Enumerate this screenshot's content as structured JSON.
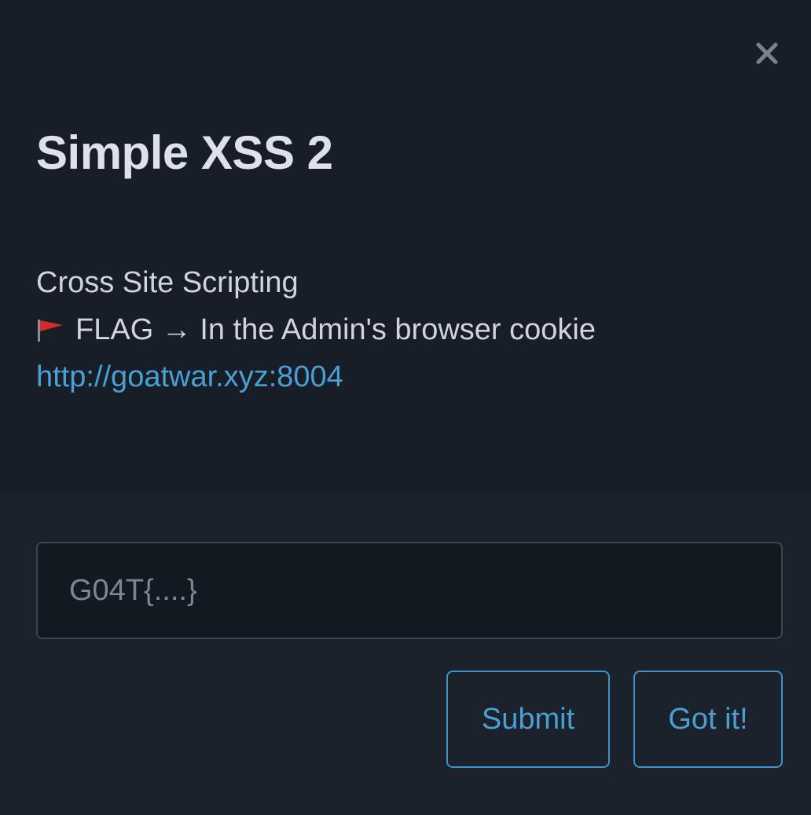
{
  "modal": {
    "title": "Simple XSS 2",
    "close_icon": "close-icon",
    "description": {
      "line1": "Cross Site Scripting",
      "flag_icon": "red-flag-icon",
      "line2": "FLAG → In the Admin's browser cookie",
      "link_text": "http://goatwar.xyz:8004"
    },
    "flag_input": {
      "value": "",
      "placeholder": "G04T{....}"
    },
    "buttons": {
      "submit_label": "Submit",
      "gotit_label": "Got it!"
    }
  },
  "colors": {
    "background_top": "#171e27",
    "background_bottom": "#1b222c",
    "accent": "#4a9fd3",
    "title": "#dde2ea",
    "text": "#d0d5dd"
  }
}
